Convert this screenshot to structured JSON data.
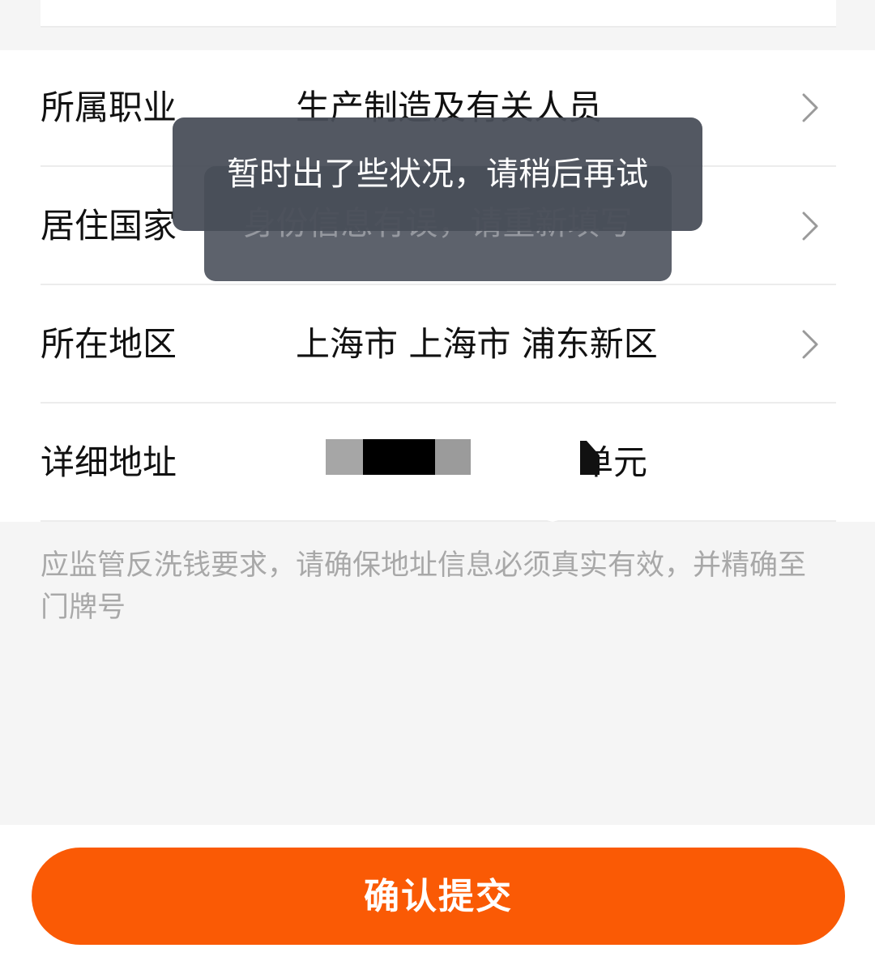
{
  "form": {
    "rows": [
      {
        "label": "所属职业",
        "value": "生产制造及有关人员"
      },
      {
        "label": "居住国家",
        "value": ""
      },
      {
        "label": "所在地区",
        "value": "上海市 上海市 浦东新区"
      },
      {
        "label": "详细地址",
        "value": "单元"
      }
    ]
  },
  "tip": "应监管反洗钱要求，请确保地址信息必须真实有效，并精确至门牌号",
  "submit_label": "确认提交",
  "toasts": {
    "front": "暂时出了些状况，请稍后再试",
    "back": "身份信息有误，请重新填写"
  },
  "colors": {
    "accent": "#fa5a05",
    "toast_bg": "#484e58"
  },
  "icons": {
    "row_arrow": "chevron-right-icon"
  }
}
